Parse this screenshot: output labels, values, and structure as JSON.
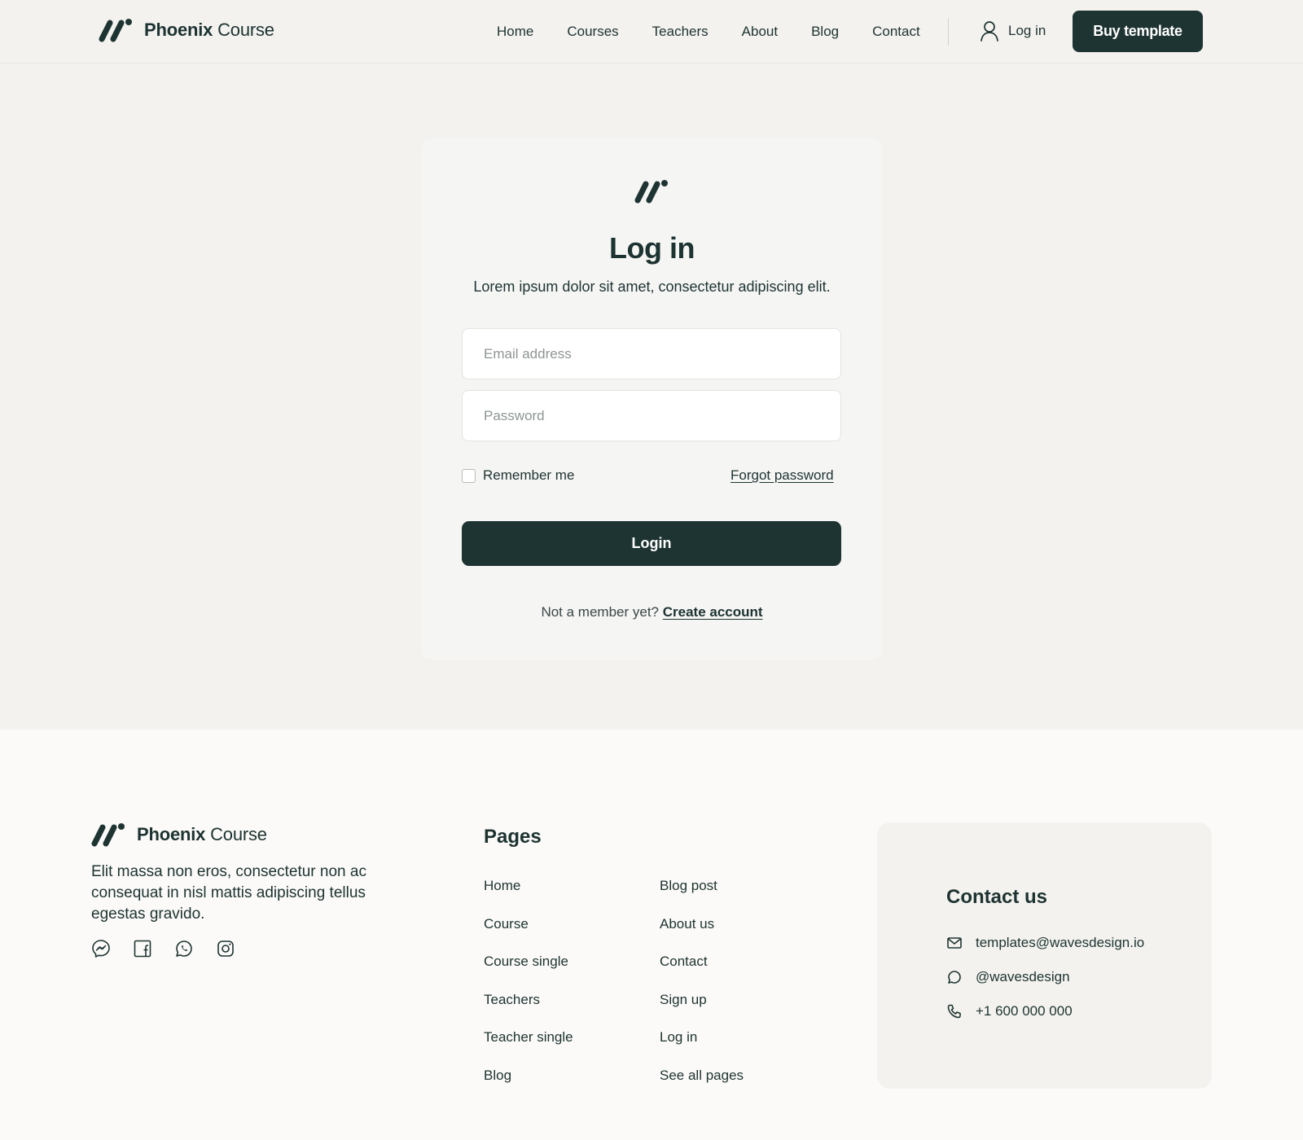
{
  "brand": {
    "name_bold": "Phoenix",
    "name_light": "Course",
    "color": "#1e3432"
  },
  "header": {
    "nav": [
      "Home",
      "Courses",
      "Teachers",
      "About",
      "Blog",
      "Contact"
    ],
    "login_label": "Log in",
    "buy_label": "Buy template"
  },
  "login_card": {
    "title": "Log in",
    "subtitle": "Lorem ipsum dolor sit amet, consectetur adipiscing elit.",
    "email_placeholder": "Email address",
    "password_placeholder": "Password",
    "remember_label": "Remember me",
    "forgot_label": "Forgot password",
    "submit_label": "Login",
    "member_text": "Not a member yet?",
    "create_label": "Create account"
  },
  "footer": {
    "description": "Elit massa non eros, consectetur non ac consequat in nisl mattis adipiscing tellus egestas gravido.",
    "socials": [
      "messenger-icon",
      "facebook-icon",
      "whatsapp-icon",
      "instagram-icon"
    ],
    "pages_title": "Pages",
    "pages_col1": [
      "Home",
      "Course",
      "Course single",
      "Teachers",
      "Teacher single",
      "Blog"
    ],
    "pages_col2": [
      "Blog post",
      "About us",
      "Contact",
      "Sign up",
      "Log in",
      "See all pages"
    ],
    "contact": {
      "title": "Contact us",
      "email": "templates@wavesdesign.io",
      "social_handle": "@wavesdesign",
      "phone": "+1 600 000 000"
    }
  }
}
